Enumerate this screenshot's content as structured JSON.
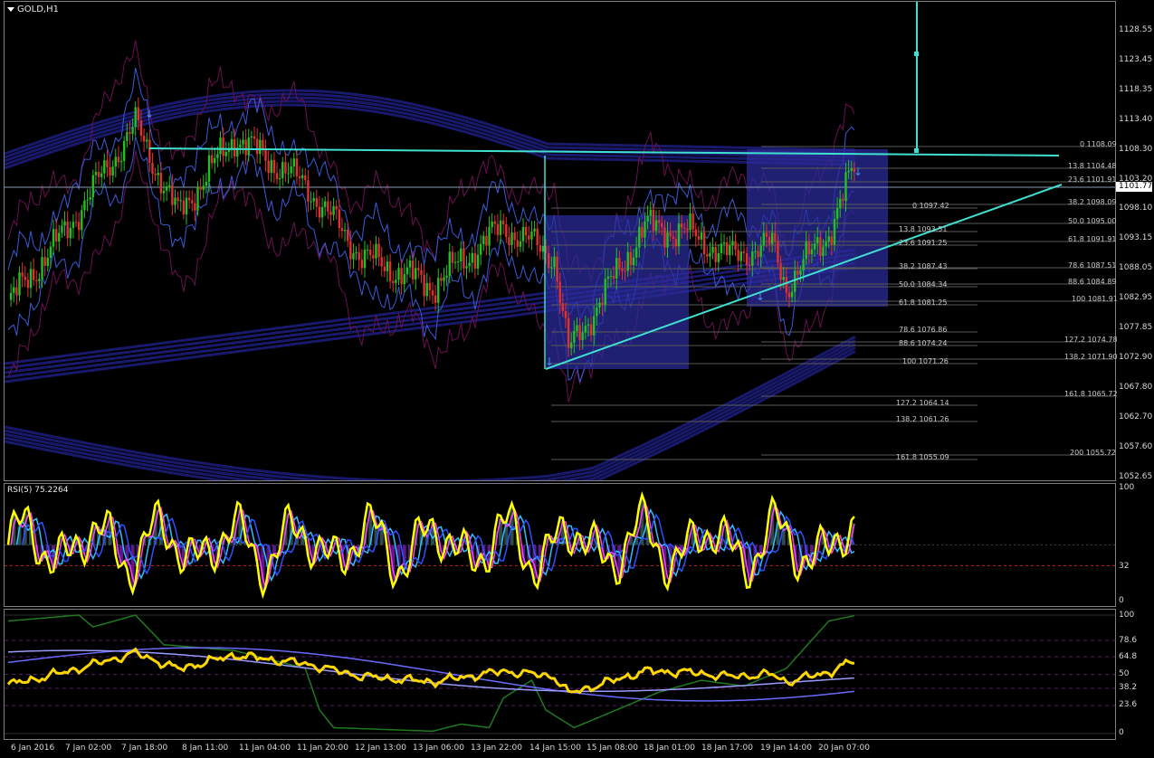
{
  "chart": {
    "symbol": "GOLD,H1",
    "current_price": "1101.77",
    "price_axis": [
      "1128.55",
      "1123.45",
      "1118.35",
      "1113.40",
      "1108.30",
      "1103.20",
      "1098.10",
      "1093.15",
      "1088.05",
      "1082.95",
      "1077.85",
      "1072.90",
      "1067.80",
      "1062.70",
      "1057.60",
      "1052.65"
    ],
    "time_axis": [
      "6 Jan 2016",
      "7 Jan 02:00",
      "7 Jan 18:00",
      "8 Jan 11:00",
      "11 Jan 04:00",
      "11 Jan 20:00",
      "12 Jan 13:00",
      "13 Jan 06:00",
      "13 Jan 22:00",
      "14 Jan 15:00",
      "15 Jan 08:00",
      "18 Jan 01:00",
      "18 Jan 17:00",
      "19 Jan 14:00",
      "20 Jan 07:00"
    ]
  },
  "fib_levels": {
    "set_a": [
      "0 1097.42",
      "13.8 1093.51",
      "23.6 1091.25",
      "38.2 1087.43",
      "50.0 1084.34",
      "61.8 1081.25",
      "78.6 1076.86",
      "88.6 1074.24",
      "100 1071.26",
      "127.2 1064.14",
      "138.2 1061.26",
      "161.8 1055.09"
    ],
    "set_b": [
      "0 1108.09",
      "13.8 1104.48",
      "23.6 1101.91",
      "38.2 1098.09",
      "50.0 1095.00",
      "61.8 1091.91",
      "78.6 1087.51",
      "88.6 1084.89",
      "100 1081.91",
      "127.2 1074.78",
      "138.2 1071.90",
      "161.8 1065.72",
      "200 1055.72"
    ]
  },
  "rsi": {
    "title": "RSI(5) 75.2264",
    "axis": [
      "100",
      "32",
      "0"
    ]
  },
  "oscillator": {
    "axis": [
      "100",
      "78.6",
      "64.8",
      "50",
      "38.2",
      "23.6",
      "0"
    ]
  },
  "colors": {
    "background": "#000000",
    "bull_candle": "#22c022",
    "bear_candle": "#e03030",
    "ribbon": "#1a1a6e",
    "fib_line": "#40e0d0",
    "box": "#2b2b9a",
    "rsi_line": "#ffff00",
    "osc_line": "#ffd700",
    "green_line": "#1f7a1f"
  }
}
